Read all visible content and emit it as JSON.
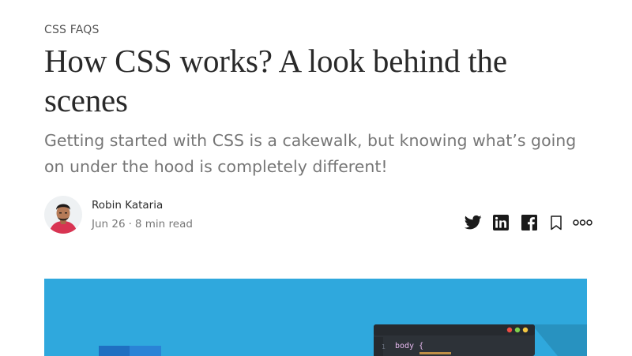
{
  "article": {
    "kicker": "CSS FAQS",
    "title": "How CSS works? A look behind the scenes",
    "subtitle": "Getting started with CSS is a cakewalk, but knowing what’s going on under the hood is completely different!"
  },
  "author": {
    "name": "Robin Kataria",
    "date": "Jun 26",
    "separator": "·",
    "read_time": "8 min read"
  },
  "share_icons": [
    "twitter-icon",
    "linkedin-icon",
    "facebook-icon",
    "bookmark-icon",
    "more-options-icon"
  ],
  "hero": {
    "code_line_number": "1",
    "code_text": "body {",
    "colors": {
      "background": "#2fa8dd",
      "editor": "#2d3238",
      "dot_red": "#ee4d43",
      "dot_green": "#7fd04c",
      "dot_yellow": "#f4c742"
    }
  }
}
